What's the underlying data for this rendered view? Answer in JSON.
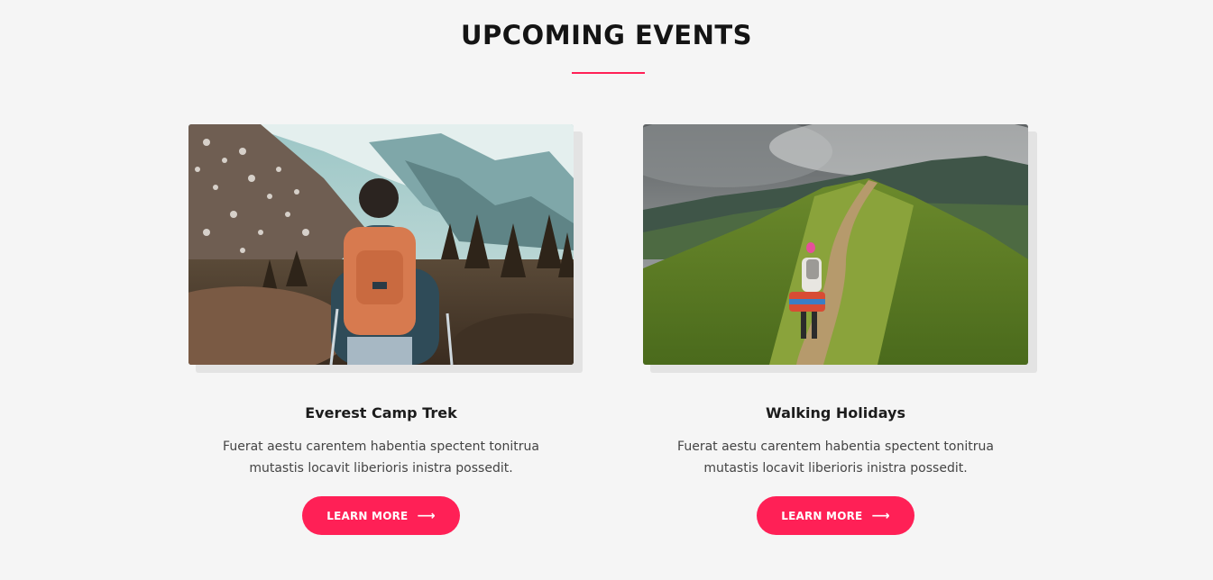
{
  "section": {
    "title": "UPCOMING EVENTS",
    "accent_color": "#ff2056"
  },
  "events": [
    {
      "image_icon": "hiker-mountain-photo",
      "title": "Everest Camp Trek",
      "description": "Fuerat aestu carentem habentia spectent tonitrua mutastis locavit liberioris inistra possedit.",
      "button_label": "LEARN MORE",
      "button_icon": "arrow-right-icon"
    },
    {
      "image_icon": "hiking-trail-photo",
      "title": "Walking Holidays",
      "description": "Fuerat aestu carentem habentia spectent tonitrua mutastis locavit liberioris inistra possedit.",
      "button_label": "LEARN MORE",
      "button_icon": "arrow-right-icon"
    }
  ]
}
